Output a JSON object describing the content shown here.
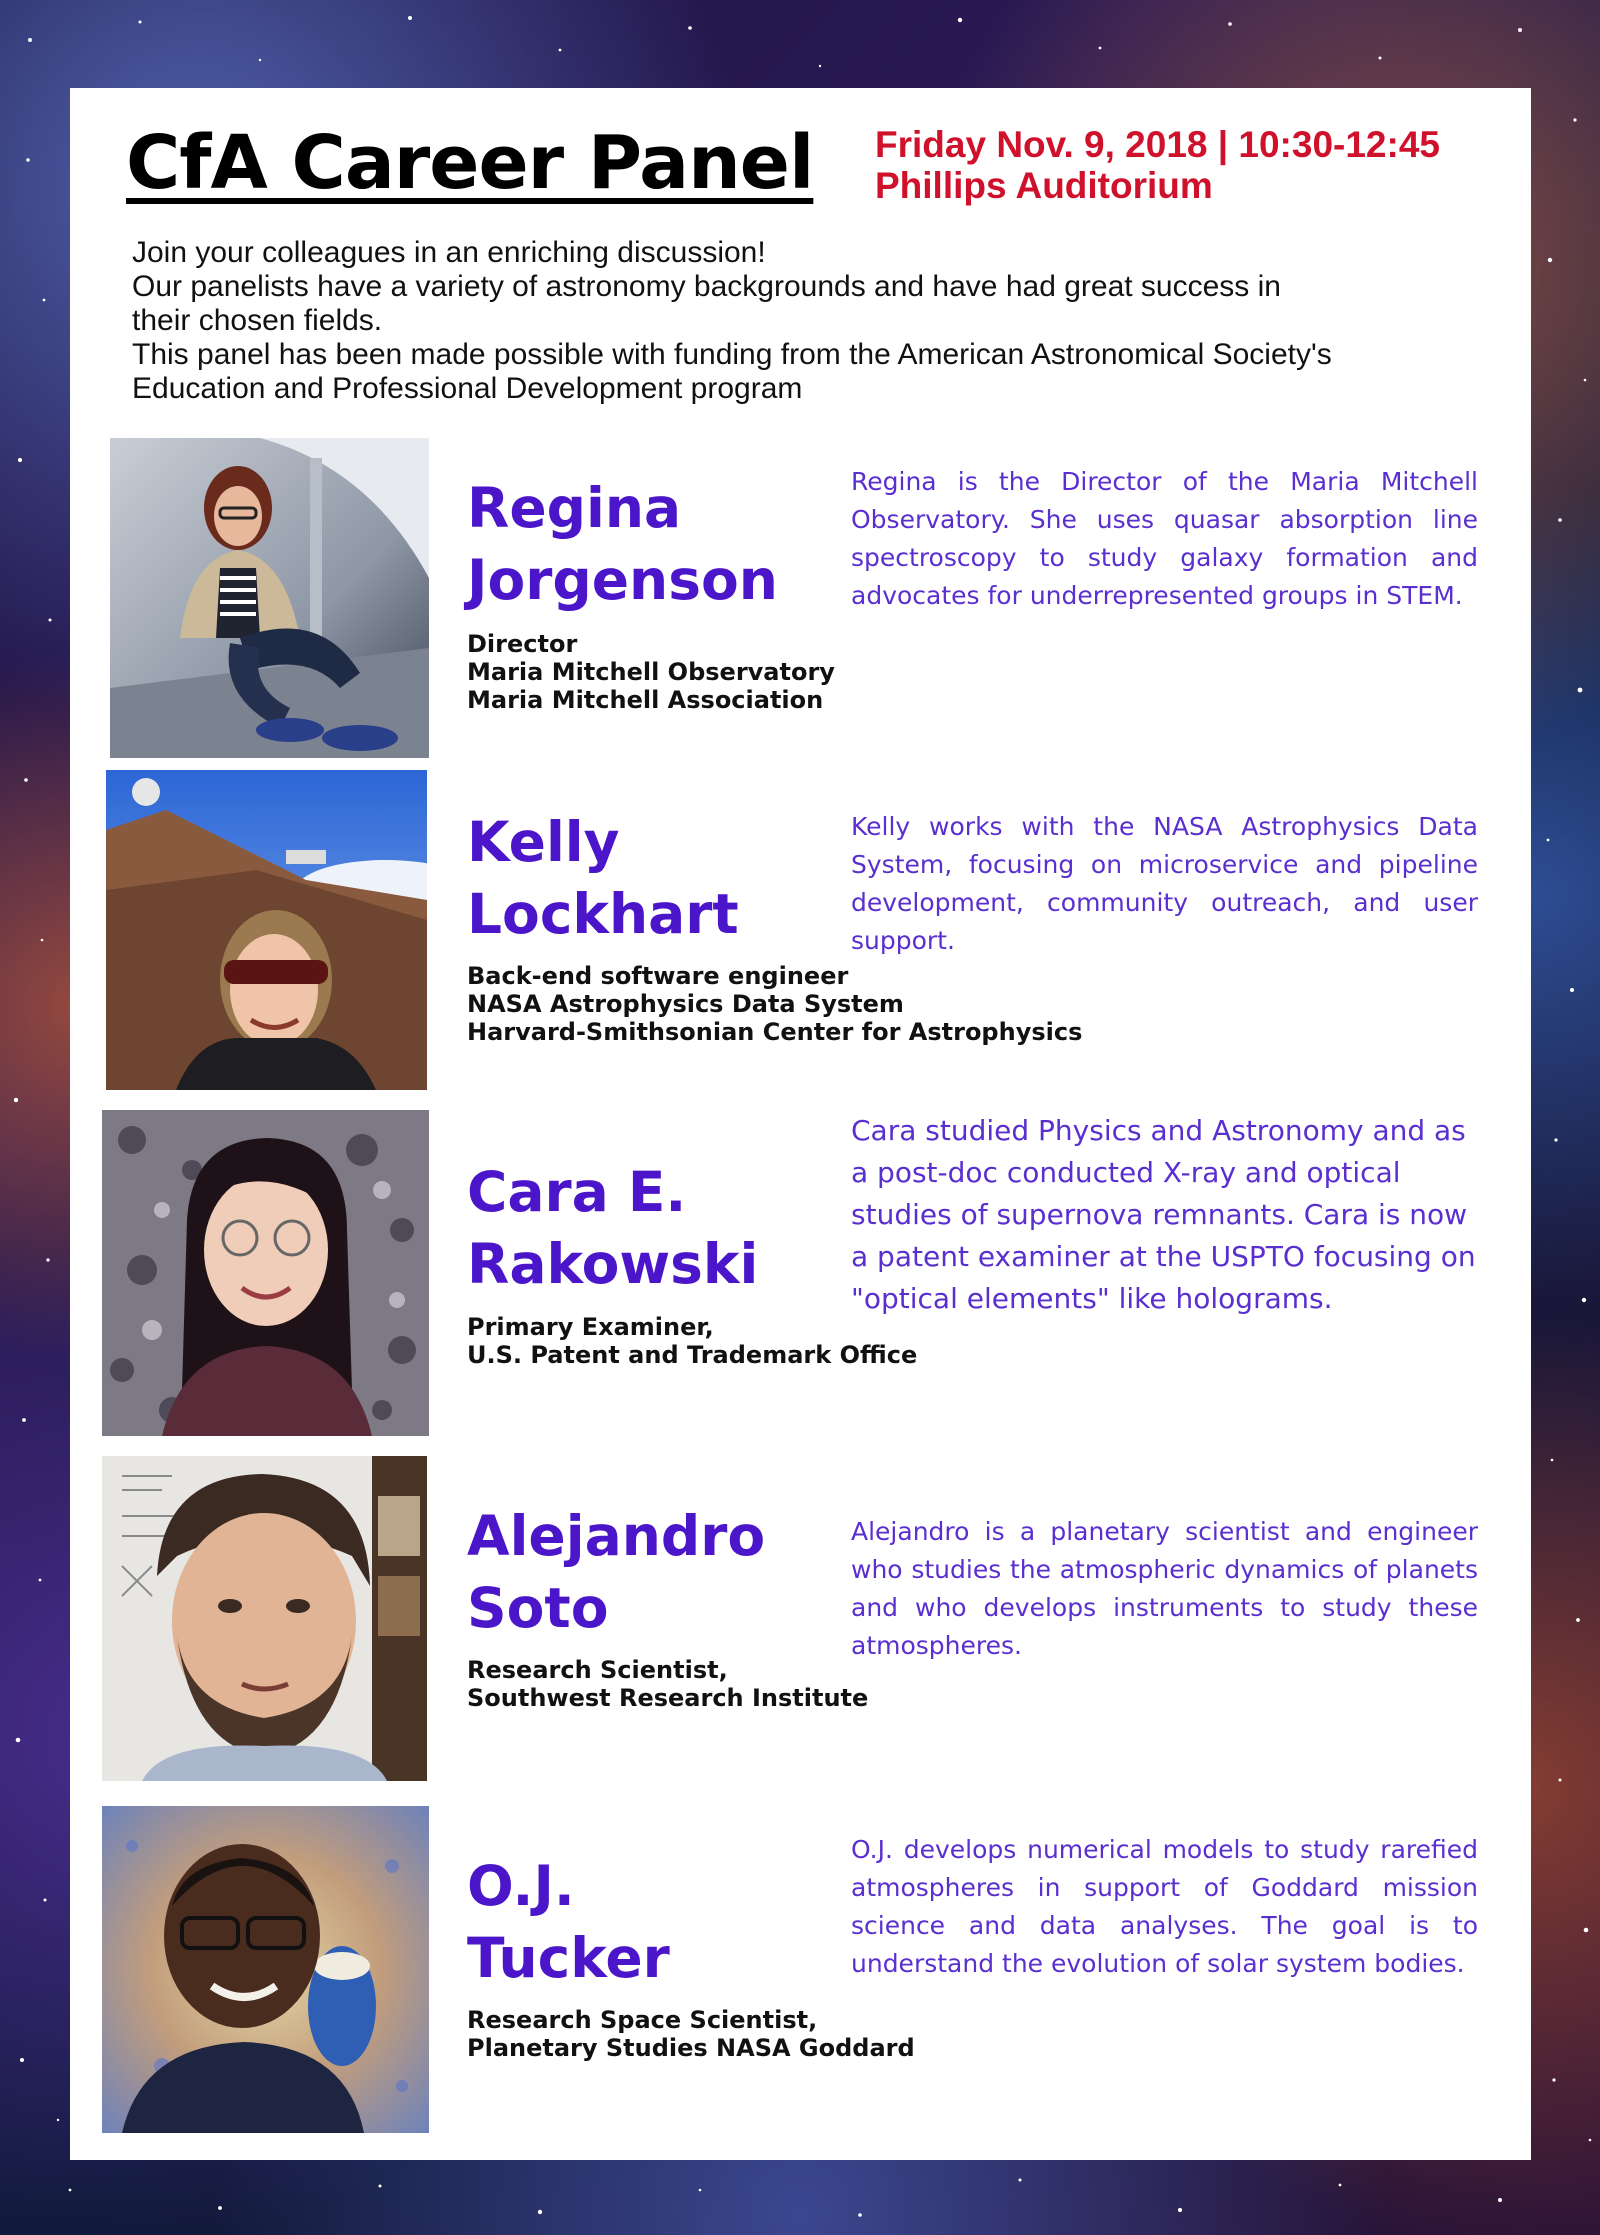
{
  "event": {
    "title": "CfA Career Panel",
    "datetime": "Friday Nov. 9, 2018 | 10:30-12:45",
    "location": "Phillips Auditorium"
  },
  "intro": {
    "line1": "Join your colleagues in an enriching discussion!",
    "line2": "Our panelists have a variety of astronomy backgrounds and have had great success in",
    "line3": "their chosen fields.",
    "line4": "This panel has been made possible with funding from the American Astronomical Society's",
    "line5": "Education and Professional Development program"
  },
  "panelists": [
    {
      "first": "Regina",
      "last": "Jorgenson",
      "role1": "Director",
      "role2": "Maria Mitchell Observatory",
      "role3": "Maria Mitchell Association",
      "bio": "Regina is the Director of the Maria Mitchell Observatory. She uses quasar absorption line spectroscopy to study galaxy formation and advocates for underrepresented groups in STEM."
    },
    {
      "first": "Kelly",
      "last": "Lockhart",
      "role1": "Back-end software engineer",
      "role2": "NASA Astrophysics Data System",
      "role3": "Harvard-Smithsonian Center for Astrophysics",
      "bio": "Kelly works with the NASA Astrophysics Data System, focusing on microservice and pipeline development, community outreach, and user support."
    },
    {
      "first": "Cara E.",
      "last": "Rakowski",
      "role1": "Primary Examiner,",
      "role2": "U.S. Patent and Trademark Office",
      "bio": "Cara studied Physics and Astronomy and as a post-doc conducted X-ray and optical studies of supernova remnants. Cara is now a patent examiner at the USPTO focusing on \"optical elements\" like holograms."
    },
    {
      "first": "Alejandro",
      "last": "Soto",
      "role1": "Research Scientist,",
      "role2": "Southwest Research Institute",
      "bio": "Alejandro is a planetary scientist and engineer who studies the atmospheric dynamics of planets and who develops instruments to study these atmospheres."
    },
    {
      "first": "O.J.",
      "last": "Tucker",
      "role1": "Research Space Scientist,",
      "role2": "Planetary Studies NASA Goddard",
      "bio": "O.J. develops numerical models to study rarefied atmospheres in support of Goddard mission science and data analyses. The goal is to understand the evolution of solar system bodies."
    }
  ]
}
